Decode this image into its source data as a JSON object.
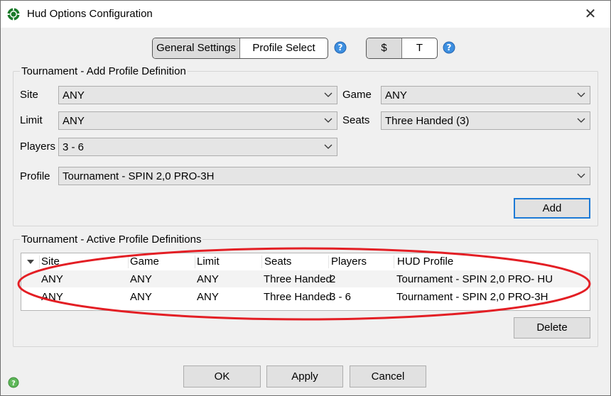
{
  "window": {
    "title": "Hud Options Configuration",
    "close_label": "✕"
  },
  "tabs": {
    "general": "General Settings",
    "profile": "Profile Select"
  },
  "toggle": {
    "dollar": "$",
    "t": "T"
  },
  "add_group": {
    "title": "Tournament - Add Profile Definition",
    "site_label": "Site",
    "site_value": "ANY",
    "game_label": "Game",
    "game_value": "ANY",
    "limit_label": "Limit",
    "limit_value": "ANY",
    "seats_label": "Seats",
    "seats_value": "Three Handed (3)",
    "players_label": "Players",
    "players_value": "3 - 6",
    "profile_label": "Profile",
    "profile_value": "Tournament - SPIN 2,0 PRO-3H",
    "add_button": "Add"
  },
  "active_group": {
    "title": "Tournament - Active Profile Definitions",
    "columns": [
      "Site",
      "Game",
      "Limit",
      "Seats",
      "Players",
      "HUD Profile"
    ],
    "rows": [
      [
        "ANY",
        "ANY",
        "ANY",
        "Three Handed",
        "2",
        "Tournament - SPIN 2,0 PRO- HU"
      ],
      [
        "ANY",
        "ANY",
        "ANY",
        "Three Handed",
        "3 - 6",
        "Tournament - SPIN 2,0 PRO-3H"
      ]
    ],
    "delete_button": "Delete"
  },
  "footer": {
    "ok": "OK",
    "apply": "Apply",
    "cancel": "Cancel"
  },
  "colors": {
    "annotation_ellipse": "#e31e24",
    "default_button_border": "#1c7ad6",
    "help_icon": "#3d8fe0",
    "app_icon": "#1a7a2a"
  },
  "icons": [
    "poker-chip-icon",
    "close-icon",
    "help-icon",
    "chevron-down-icon",
    "sort-arrow-icon",
    "status-icon"
  ]
}
